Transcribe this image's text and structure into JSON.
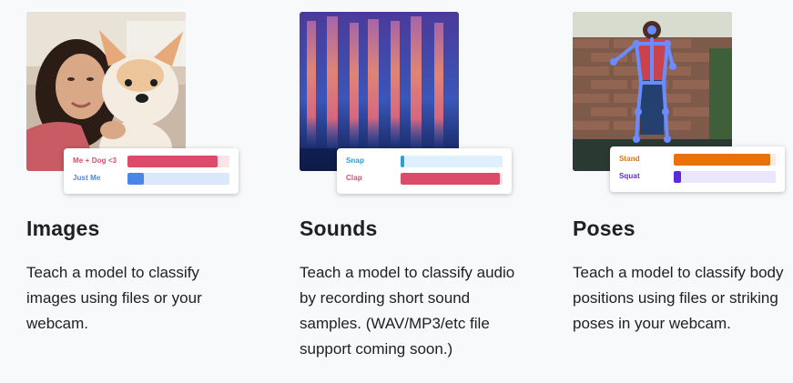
{
  "cards": [
    {
      "title": "Images",
      "description": "Teach a model to classify images using files or your webcam.",
      "thumbnail": "photo-girl-with-plush-dog",
      "bars": [
        {
          "label": "Me + Dog <3",
          "value": 0.88,
          "fill": "#dc4c6a",
          "track": "#fbe3e8",
          "label_color": "#dc4c6a"
        },
        {
          "label": "Just Me",
          "value": 0.16,
          "fill": "#4a86e8",
          "track": "#dbe7fb",
          "label_color": "#4a86e8"
        }
      ]
    },
    {
      "title": "Sounds",
      "description": "Teach a model to classify audio by recording short sound samples. (WAV/MP3/etc file support coming soon.)",
      "thumbnail": "spectrogram",
      "bars": [
        {
          "label": "Snap",
          "value": 0.04,
          "fill": "#2a9fd8",
          "track": "#ddf0fb",
          "label_color": "#2a9fd8"
        },
        {
          "label": "Clap",
          "value": 0.97,
          "fill": "#dc4c6a",
          "track": "#fbe3e8",
          "label_color": "#dc4c6a"
        }
      ]
    },
    {
      "title": "Poses",
      "description": "Teach a model to classify body positions using files or striking poses in your webcam.",
      "thumbnail": "pose-skeleton-photo",
      "bars": [
        {
          "label": "Stand",
          "value": 0.95,
          "fill": "#e8710a",
          "track": "#fde9d6",
          "label_color": "#e8710a"
        },
        {
          "label": "Squat",
          "value": 0.07,
          "fill": "#5c2bd6",
          "track": "#ebe6fb",
          "label_color": "#5c2bd6"
        }
      ]
    }
  ]
}
